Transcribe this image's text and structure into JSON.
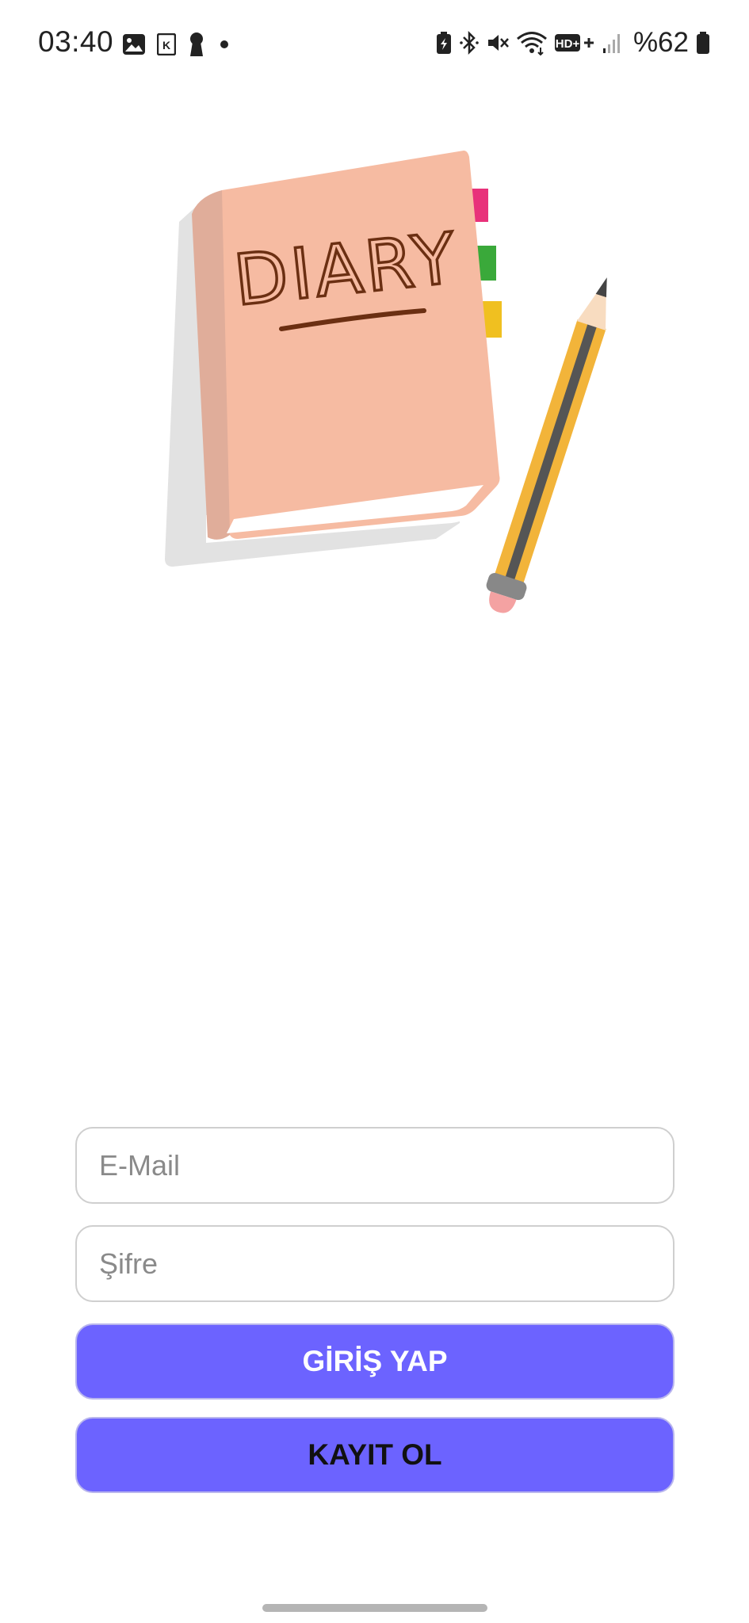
{
  "status_bar": {
    "time": "03:40",
    "battery_text": "%62",
    "left_icons": [
      "gallery-icon",
      "k-app-icon",
      "keyhole-icon",
      "notification-dot-icon"
    ],
    "right_icons": [
      "battery-saver-icon",
      "bluetooth-icon",
      "mute-icon",
      "wifi-icon",
      "hd-plus-icon",
      "signal-icon",
      "battery-icon"
    ],
    "hd_label": "HD+"
  },
  "illustration": {
    "cover_text": "DIARY",
    "colors": {
      "cover": "#f6bba2",
      "spine": "#e0ad9a",
      "shadow": "#e2e2e2",
      "tab_pink": "#e8317a",
      "tab_green": "#3aa93a",
      "tab_yellow": "#f0c020",
      "pencil_body": "#f2b43a",
      "pencil_stripe": "#555555",
      "ink": "#6b2f12"
    }
  },
  "form": {
    "email_placeholder": "E-Mail",
    "email_value": "",
    "password_placeholder": "Şifre",
    "password_value": "",
    "login_label": "GİRİŞ YAP",
    "register_label": "KAYIT OL"
  },
  "colors": {
    "accent": "#6c63ff",
    "field_border": "#cfcfcf"
  }
}
